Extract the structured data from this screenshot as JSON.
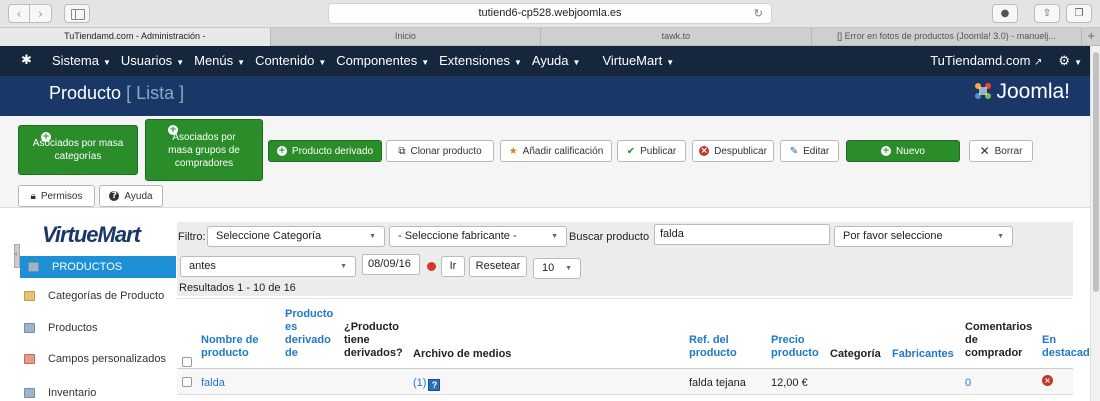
{
  "browser": {
    "url": "tutiend6-cp528.webjoomla.es",
    "tabs": [
      {
        "label": "TuTiendamd.com - Administración -"
      },
      {
        "label": "Inicio"
      },
      {
        "label": "tawk.to"
      },
      {
        "label": "[] Error en fotos de productos (Joomla! 3.0) - manuelj..."
      }
    ]
  },
  "admin_menu": {
    "items": [
      {
        "label": "Sistema"
      },
      {
        "label": "Usuarios"
      },
      {
        "label": "Menús"
      },
      {
        "label": "Contenido"
      },
      {
        "label": "Componentes"
      },
      {
        "label": "Extensiones"
      },
      {
        "label": "Ayuda"
      },
      {
        "label": "VirtueMart"
      }
    ],
    "site_link": "TuTiendamd.com",
    "settings": "⚙"
  },
  "header": {
    "title": "Producto",
    "subtitle": "[ Lista ]",
    "brand": "Joomla!"
  },
  "toolbar": {
    "assoc_cat": "Asociados por masa categorías",
    "assoc_group": "Asociados por masa grupos de compradores",
    "derived": "Producto derivado",
    "clone": "Clonar producto",
    "rate": "Añadir calificación",
    "publish": "Publicar",
    "unpublish": "Despublicar",
    "edit": "Editar",
    "new": "Nuevo",
    "delete": "Borrar",
    "permissions": "Permisos",
    "help": "Ayuda"
  },
  "sidebar": {
    "logo": "VirtueMart",
    "items": [
      {
        "label": "PRODUCTOS"
      },
      {
        "label": "Categorías de Producto"
      },
      {
        "label": "Productos"
      },
      {
        "label": "Campos personalizados"
      },
      {
        "label": "Inventario"
      }
    ]
  },
  "filters": {
    "filter_label": "Filtro:",
    "category": "Seleccione Categoría",
    "manufacturer": "- Seleccione fabricante -",
    "search_label": "Buscar producto",
    "search_value": "falda",
    "search_type": "Por favor seleccione",
    "date_mode": "antes",
    "date": "08/09/16",
    "go": "Ir",
    "reset": "Resetear",
    "limit": "10"
  },
  "results": "Resultados 1 - 10 de 16",
  "table": {
    "columns": {
      "name": "Nombre de producto",
      "derived_of": "Producto es derivado de",
      "has_derived": "¿Producto tiene derivados?",
      "media": "Archivo de medios",
      "sku": "Ref. del producto",
      "price": "Precio producto",
      "category": "Categoría",
      "manufacturers": "Fabricantes",
      "reviews": "Comentarios de comprador",
      "featured": "En destacad"
    },
    "rows": [
      {
        "name": "falda",
        "media_count": "(1)",
        "media_help": "?",
        "sku": "falda tejana",
        "price": "12,00 €",
        "reviews": "0"
      }
    ]
  }
}
